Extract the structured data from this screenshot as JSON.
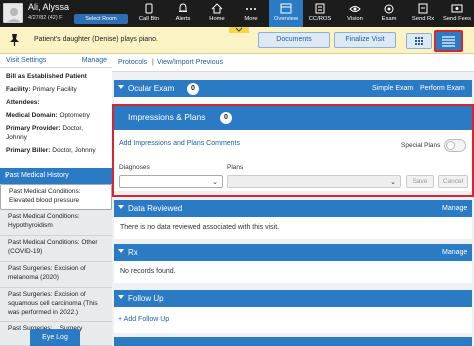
{
  "patient": {
    "name": "Ali, Alyssa",
    "info": "4/27/82 (42) F",
    "select_room": "Select Room"
  },
  "nav": [
    {
      "label": "Call Btn",
      "icon": "phone-icon"
    },
    {
      "label": "Alerts",
      "icon": "bell-icon"
    },
    {
      "label": "Home",
      "icon": "home-icon"
    },
    {
      "label": "More",
      "icon": "more-icon"
    },
    {
      "label": "Overview",
      "icon": "overview-icon"
    },
    {
      "label": "CC/ROS",
      "icon": "ccros-icon"
    },
    {
      "label": "Vision",
      "icon": "vision-icon"
    },
    {
      "label": "Exam",
      "icon": "exam-icon"
    },
    {
      "label": "Send Rx",
      "icon": "send-rx-icon"
    },
    {
      "label": "Send Fees",
      "icon": "send-fees-icon"
    }
  ],
  "banner": {
    "text": "Patient's daughter (Denise) plays piano.",
    "documents": "Documents",
    "finalize": "Finalize Visit"
  },
  "visit_settings": {
    "title": "Visit Settings",
    "manage": "Manage",
    "lines": [
      {
        "label": "Bill as Established Patient",
        "value": ""
      },
      {
        "label": "Facility:",
        "value": " Primary Facility"
      },
      {
        "label": "Attendees:",
        "value": ""
      },
      {
        "label": "Medical Domain:",
        "value": " Optometry"
      },
      {
        "label": "Primary Provider:",
        "value": " Doctor,"
      },
      {
        "label": "",
        "value": "Johnny"
      },
      {
        "label": "Primary Biller:",
        "value": " Doctor, Johnny"
      }
    ]
  },
  "history": {
    "title": "Past Medical History",
    "items": [
      "Past Medical Conditions: Elevated blood pressure",
      "Past Medical Conditions: Hypothyroidism",
      "Past Medical Conditions: Other (COVID-19)",
      "Past Surgeries: Excision of melanoma (2020)",
      "Past Surgeries: Excision of squamous cell carcinoma (This was performed in 2022.)",
      "Past Surgeries: ...Surgery"
    ]
  },
  "eye_log": "Eye Log",
  "protocols": {
    "link1": "Protocols",
    "sep": "|",
    "link2": "View/Import Previous"
  },
  "ocular": {
    "title": "Ocular Exam",
    "count": "0",
    "simple": "Simple Exam",
    "perform": "Perform Exam"
  },
  "impressions": {
    "title": "Impressions & Plans",
    "count": "0",
    "add": "Add Impressions and Plans Comments",
    "special": "Special Plans",
    "diagnoses": "Diagnoses",
    "plans": "Plans",
    "save": "Save",
    "cancel": "Cancel"
  },
  "data_reviewed": {
    "title": "Data Reviewed",
    "manage": "Manage",
    "empty": "There is no data reviewed associated with this visit."
  },
  "rx": {
    "title": "Rx",
    "manage": "Manage",
    "empty": "No records found."
  },
  "followup": {
    "title": "Follow Up",
    "add": "+ Add Follow Up"
  },
  "colors": {
    "accent": "#2a7ac4",
    "highlight": "#d9262c",
    "banner": "#fbf3c4",
    "topbar": "#1c1c1c"
  }
}
